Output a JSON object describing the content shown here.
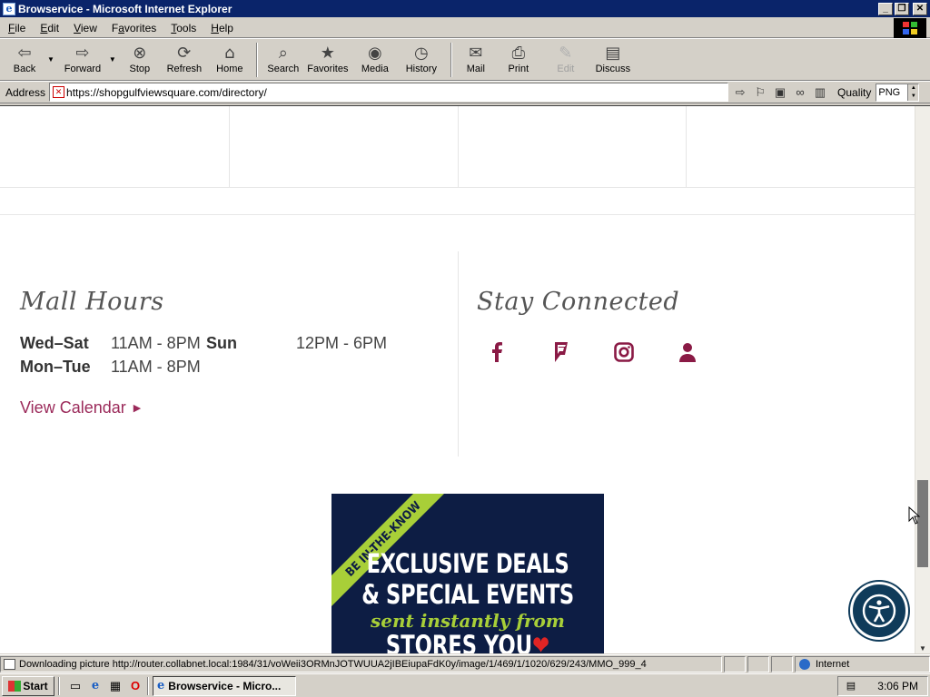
{
  "window": {
    "title": "Browservice - Microsoft Internet Explorer"
  },
  "menubar": {
    "items": [
      {
        "label": "File",
        "accel": "F",
        "rest": "ile"
      },
      {
        "label": "Edit",
        "accel": "E",
        "rest": "dit"
      },
      {
        "label": "View",
        "accel": "V",
        "rest": "iew"
      },
      {
        "label": "Favorites",
        "accel": "a",
        "pre": "F",
        "rest": "vorites"
      },
      {
        "label": "Tools",
        "accel": "T",
        "rest": "ools"
      },
      {
        "label": "Help",
        "accel": "H",
        "rest": "elp"
      }
    ]
  },
  "toolbar": {
    "back": "Back",
    "forward": "Forward",
    "stop": "Stop",
    "refresh": "Refresh",
    "home": "Home",
    "search": "Search",
    "favorites": "Favorites",
    "media": "Media",
    "history": "History",
    "mail": "Mail",
    "print": "Print",
    "edit": "Edit",
    "discuss": "Discuss"
  },
  "addressbar": {
    "label": "Address",
    "url": "https://shopgulfviewsquare.com/directory/",
    "quality_label": "Quality",
    "quality_value": "PNG"
  },
  "page": {
    "mall_hours": {
      "heading": "Mall Hours",
      "row1_day": "Wed–Sat",
      "row1_time": "11AM - 8PM",
      "row1_day2": "Sun",
      "row1_time2": "12PM - 6PM",
      "row2_day": "Mon–Tue",
      "row2_time": "11AM - 8PM",
      "calendar_link": "View Calendar"
    },
    "stay_connected": {
      "heading": "Stay Connected",
      "icons": [
        "facebook-icon",
        "foursquare-icon",
        "instagram-icon",
        "user-icon"
      ]
    },
    "promo": {
      "ribbon": "BE IN-THE-KNOW",
      "line1": "EXCLUSIVE DEALS",
      "line2": "& SPECIAL EVENTS",
      "line3": "sent instantly from",
      "line4": "STORES YOU"
    }
  },
  "statusbar": {
    "text": "Downloading picture http://router.collabnet.local:1984/31/voWeii3ORMnJOTWUUA2jIBEiupaFdK0y/image/1/469/1/1020/629/243/MMO_999_4",
    "zone": "Internet"
  },
  "taskbar": {
    "start": "Start",
    "task_label": "Browservice - Micro...",
    "clock": "3:06 PM"
  },
  "colors": {
    "accent": "#9b2a5a",
    "promo_bg": "#0d1d44",
    "promo_green": "#a8cf38",
    "a11y": "#0f3b5a"
  }
}
